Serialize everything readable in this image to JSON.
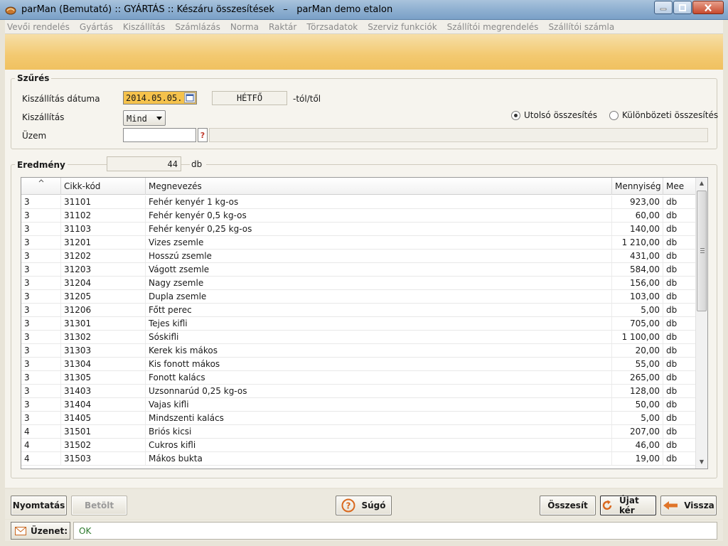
{
  "window": {
    "title": "parMan (Bemutató) :: GYÁRTÁS :: Készáru összesítések   –   parMan demo etalon"
  },
  "menu": [
    "Vevői rendelés",
    "Gyártás",
    "Kiszállítás",
    "Számlázás",
    "Norma",
    "Raktár",
    "Törzsadatok",
    "Szerviz funkciók",
    "Szállítói megrendelés",
    "Szállítói számla"
  ],
  "filter": {
    "title": "Szűrés",
    "date_label": "Kiszállítás dátuma",
    "date_value": "2014.05.05.",
    "day_value": "HÉTFŐ",
    "from_suffix": "-tól/től",
    "delivery_label": "Kiszállítás",
    "delivery_value": "Mind",
    "plant_label": "Üzem",
    "plant_value": "",
    "plant_lookup": "?",
    "radio_last": "Utolsó összesítés",
    "radio_diff": "Különbözeti összesítés",
    "radio_selected": "last"
  },
  "result": {
    "title": "Eredmény",
    "count": "44",
    "unit": "db"
  },
  "table": {
    "columns": [
      "",
      "Cikk-kód",
      "Megnevezés",
      "Mennyiség",
      "Mee"
    ],
    "rows": [
      [
        "3",
        "31101",
        "Fehér kenyér 1 kg-os",
        "923,00",
        "db"
      ],
      [
        "3",
        "31102",
        "Fehér kenyér 0,5 kg-os",
        "60,00",
        "db"
      ],
      [
        "3",
        "31103",
        "Fehér kenyér 0,25 kg-os",
        "140,00",
        "db"
      ],
      [
        "3",
        "31201",
        "Vizes zsemle",
        "1 210,00",
        "db"
      ],
      [
        "3",
        "31202",
        "Hosszú zsemle",
        "431,00",
        "db"
      ],
      [
        "3",
        "31203",
        "Vágott zsemle",
        "584,00",
        "db"
      ],
      [
        "3",
        "31204",
        "Nagy zsemle",
        "156,00",
        "db"
      ],
      [
        "3",
        "31205",
        "Dupla zsemle",
        "103,00",
        "db"
      ],
      [
        "3",
        "31206",
        "Főtt perec",
        "5,00",
        "db"
      ],
      [
        "3",
        "31301",
        "Tejes kifli",
        "705,00",
        "db"
      ],
      [
        "3",
        "31302",
        "Sóskifli",
        "1 100,00",
        "db"
      ],
      [
        "3",
        "31303",
        "Kerek kis mákos",
        "20,00",
        "db"
      ],
      [
        "3",
        "31304",
        "Kis fonott mákos",
        "55,00",
        "db"
      ],
      [
        "3",
        "31305",
        "Fonott kalács",
        "265,00",
        "db"
      ],
      [
        "3",
        "31403",
        "Uzsonnarúd 0,25 kg-os",
        "128,00",
        "db"
      ],
      [
        "3",
        "31404",
        "Vajas kifli",
        "50,00",
        "db"
      ],
      [
        "3",
        "31405",
        "Mindszenti kalács",
        "5,00",
        "db"
      ],
      [
        "4",
        "31501",
        "Briós kicsi",
        "207,00",
        "db"
      ],
      [
        "4",
        "31502",
        "Cukros kifli",
        "46,00",
        "db"
      ],
      [
        "4",
        "31503",
        "Mákos bukta",
        "19,00",
        "db"
      ]
    ]
  },
  "buttons": {
    "print": "Nyomtatás",
    "load": "Betölt",
    "help": "Súgó",
    "summarize": "Összesít",
    "new_request": "Újat kér",
    "back": "Vissza"
  },
  "status": {
    "message_label": "Üzenet:",
    "message_text": "OK"
  }
}
